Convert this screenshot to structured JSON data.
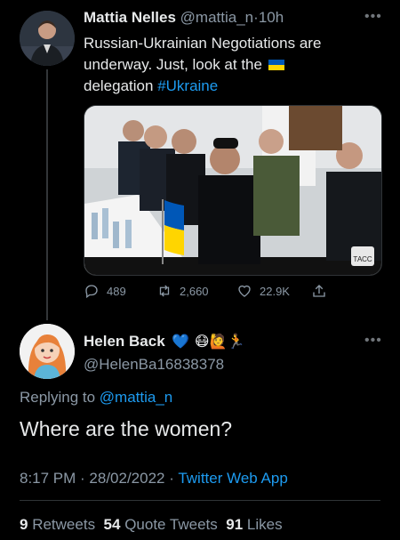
{
  "tweet": {
    "author_name": "Mattia Nelles",
    "author_handle": "@mattia_n",
    "separator": "·",
    "time": "10h",
    "text_line1": "Russian-Ukrainian Negotiations are",
    "text_line2": "underway. Just, look at the",
    "text_line3_prefix": "delegation ",
    "hashtag": "#Ukraine",
    "photo_watermark": "ТАСС",
    "actions": {
      "replies": "489",
      "retweets": "2,660",
      "likes": "22.9K"
    }
  },
  "reply": {
    "author_name": "Helen Back",
    "name_emojis": "💙 😷🙋🏃",
    "author_handle": "@HelenBa16838378",
    "replying_prefix": "Replying to ",
    "replying_to": "@mattia_n",
    "text": "Where are the women?",
    "time": "8:17 PM",
    "date": "28/02/2022",
    "meta_sep": " · ",
    "app": "Twitter Web App",
    "stats": {
      "retweets_count": "9",
      "retweets_label": "Retweets",
      "quotes_count": "54",
      "quotes_label": "Quote Tweets",
      "likes_count": "91",
      "likes_label": "Likes"
    }
  },
  "icons": {
    "more": "more-horizontal-icon",
    "reply": "reply-icon",
    "retweet": "retweet-icon",
    "like": "heart-icon",
    "share": "share-icon"
  },
  "colors": {
    "background": "#000000",
    "text": "#e7e9ea",
    "secondary": "#8b98a5",
    "link": "#1d9bf0",
    "flag_blue": "#0057b7",
    "flag_yellow": "#ffd500"
  }
}
